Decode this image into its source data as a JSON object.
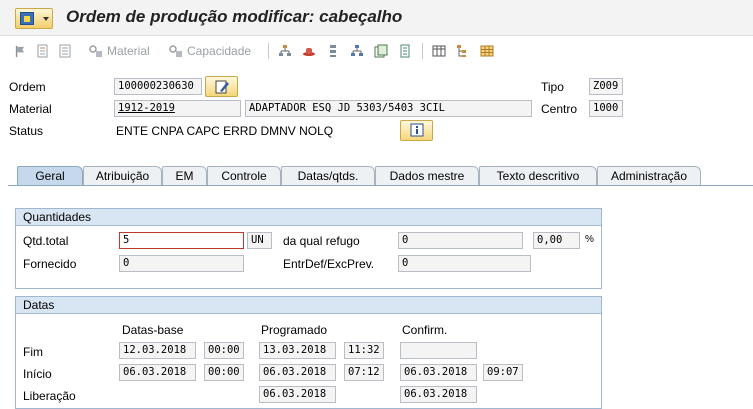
{
  "window": {
    "title": "Ordem de produção modificar: cabeçalho"
  },
  "toolbar": {
    "material_label": "Material",
    "capacidade_label": "Capacidade"
  },
  "header": {
    "ordem_label": "Ordem",
    "ordem_value": "100000230630",
    "material_label": "Material",
    "material_value": "1912-2019",
    "material_desc": "ADAPTADOR ESQ JD 5303/5403 3CIL",
    "status_label": "Status",
    "status_value": "ENTE CNPA CAPC ERRD DMNV NOLQ",
    "tipo_label": "Tipo",
    "tipo_value": "Z009",
    "centro_label": "Centro",
    "centro_value": "1000"
  },
  "tabs": [
    {
      "label": "Geral",
      "active": true
    },
    {
      "label": "Atribuição"
    },
    {
      "label": "EM"
    },
    {
      "label": "Controle"
    },
    {
      "label": "Datas/qtds."
    },
    {
      "label": "Dados mestre"
    },
    {
      "label": "Texto descritivo"
    },
    {
      "label": "Administração"
    }
  ],
  "quantidades": {
    "title": "Quantidades",
    "qtd_total_label": "Qtd.total",
    "qtd_total_value": "5",
    "unit": "UN",
    "refugo_label": "da qual refugo",
    "refugo_value": "0",
    "refugo_pct_value": "0,00",
    "pct_sign": "%",
    "fornecido_label": "Fornecido",
    "fornecido_value": "0",
    "entrdef_label": "EntrDef/ExcPrev.",
    "entrdef_value": "0"
  },
  "datas": {
    "title": "Datas",
    "col_base": "Datas-base",
    "col_programado": "Programado",
    "col_confirm": "Confirm.",
    "fim_label": "Fim",
    "inicio_label": "Início",
    "liberacao_label": "Liberação",
    "fim_base_date": "12.03.2018",
    "fim_base_time": "00:00",
    "fim_prog_date": "13.03.2018",
    "fim_prog_time": "11:32",
    "fim_conf_date": "",
    "inicio_base_date": "06.03.2018",
    "inicio_base_time": "00:00",
    "inicio_prog_date": "06.03.2018",
    "inicio_prog_time": "07:12",
    "inicio_conf_date": "06.03.2018",
    "inicio_conf_time": "09:07",
    "lib_prog_date": "06.03.2018",
    "lib_conf_date": "06.03.2018"
  }
}
